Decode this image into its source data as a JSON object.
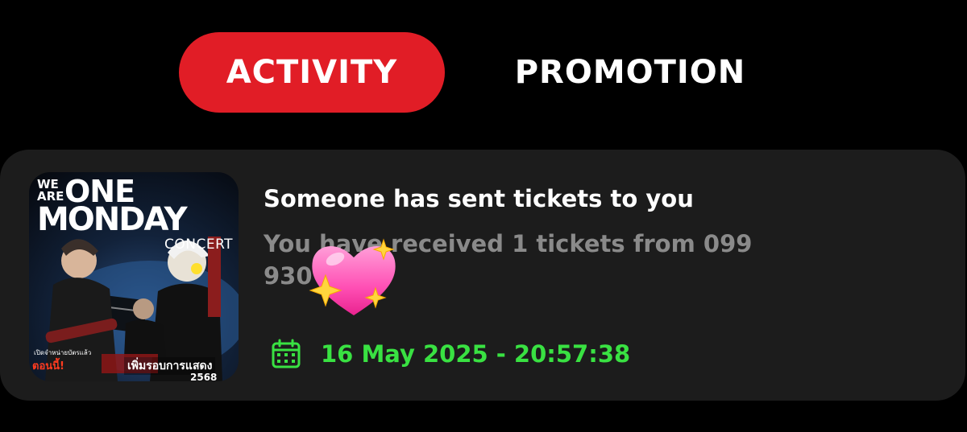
{
  "tabs": {
    "activity_label": "ACTIVITY",
    "promotion_label": "PROMOTION",
    "active": "ACTIVITY"
  },
  "notification": {
    "title": "Someone has sent tickets to you",
    "body": "You have received 1 tickets from 099        930",
    "datetime": "16 May 2025 - 20:57:38",
    "poster": {
      "we_are": "WE ARE",
      "one": "ONE",
      "monday": "MONDAY",
      "concert": "CONCERT",
      "cta": "ตอนนี้!",
      "subtitle": "เปิดจำหน่ายบัตรแล้ว",
      "extra_show": "เพิ่มรอบการแสดง",
      "year": "2568"
    }
  },
  "icons": {
    "calendar": "calendar-icon",
    "sticker": "sparkling-heart-icon"
  },
  "colors": {
    "background": "#000000",
    "card": "#1c1c1c",
    "active_tab": "#e11d26",
    "date_green": "#39e142",
    "muted_text": "#8a8a8a"
  }
}
